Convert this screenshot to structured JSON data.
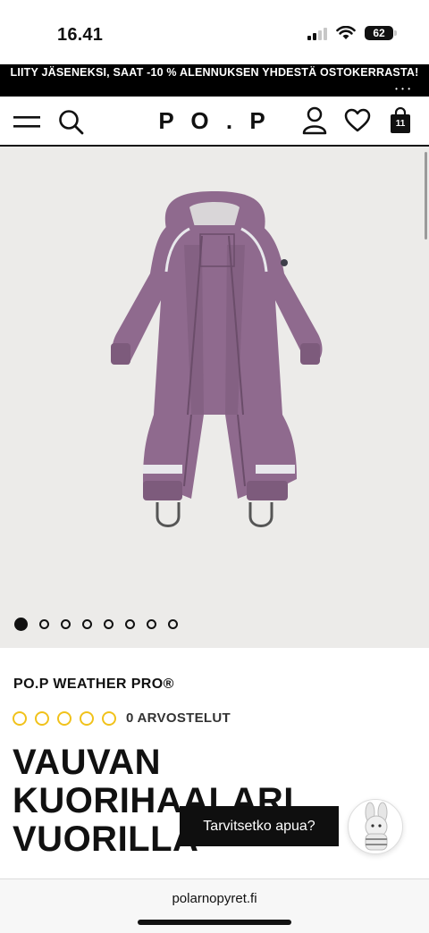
{
  "status_bar": {
    "time": "16.41",
    "battery_level": "62"
  },
  "promo_banner": {
    "text": "LIITY JÄSENEKSI, SAAT -10 % ALENNUKSEN YHDESTÄ OSTOKERRASTA!"
  },
  "nav": {
    "logo": "P O . P",
    "bag_count": "11",
    "icons": [
      "menu-icon",
      "search-icon",
      "account-icon",
      "wishlist-icon",
      "bag-icon"
    ]
  },
  "gallery": {
    "image_description_icon": "purple-snowsuit-image",
    "total_images": 8,
    "active_index": 0
  },
  "product": {
    "brand": "PO.P WEATHER PRO®",
    "rating_text": "0 ARVOSTELUT",
    "rating_value": 0,
    "rating_max": 5,
    "title_lines": [
      "VAUVAN",
      "KUORIHAALARI",
      "VUORILLA"
    ]
  },
  "chat": {
    "bubble_text": "Tarvitsetko apua?"
  },
  "browser": {
    "url": "polarnopyret.fi"
  },
  "colors": {
    "accent_star": "#f1c21b",
    "suit_purple": "#8f6a8e",
    "banner_bg": "#000000"
  }
}
